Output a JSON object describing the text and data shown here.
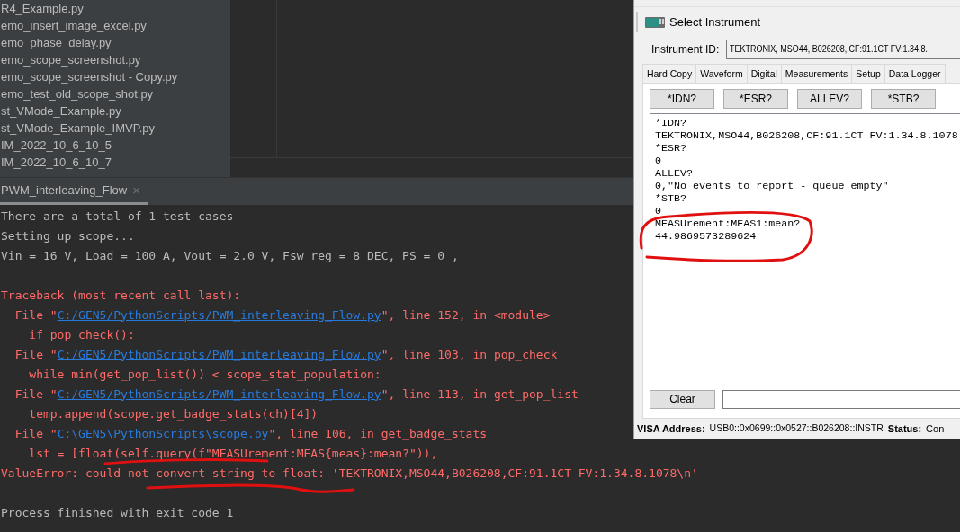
{
  "project_tree": {
    "files": [
      "R4_Example.py",
      "emo_insert_image_excel.py",
      "emo_phase_delay.py",
      "emo_scope_screenshot.py",
      "emo_scope_screenshot - Copy.py",
      "emo_test_old_scope_shot.py",
      "st_VMode_Example.py",
      "st_VMode_Example_IMVP.py",
      "IM_2022_10_6_10_5",
      "IM_2022_10_6_10_7"
    ]
  },
  "run_tab": {
    "label": "PWM_interleaving_Flow",
    "close": "×"
  },
  "console": {
    "blocks": [
      {
        "lines": [
          {
            "segments": [
              {
                "kind": "out",
                "text": "There are a total of 1 test cases"
              }
            ]
          },
          {
            "segments": [
              {
                "kind": "out",
                "text": "Setting up scope..."
              }
            ]
          },
          {
            "segments": [
              {
                "kind": "out",
                "text": "Vin = 16 V, Load = 100 A, Vout = 2.0 V, Fsw reg = 8 DEC, PS = 0 ,"
              }
            ]
          }
        ]
      },
      {
        "lines": [
          {
            "segments": [
              {
                "kind": "err",
                "text": "Traceback (most recent call last):"
              }
            ]
          },
          {
            "segments": [
              {
                "kind": "err",
                "text": "  File \""
              },
              {
                "kind": "link",
                "text": "C:/GEN5/PythonScripts/PWM_interleaving_Flow.py"
              },
              {
                "kind": "err",
                "text": "\", line 152, in <module>"
              }
            ]
          },
          {
            "segments": [
              {
                "kind": "err",
                "text": "    if pop_check():"
              }
            ]
          },
          {
            "segments": [
              {
                "kind": "err",
                "text": "  File \""
              },
              {
                "kind": "link",
                "text": "C:/GEN5/PythonScripts/PWM_interleaving_Flow.py"
              },
              {
                "kind": "err",
                "text": "\", line 103, in pop_check"
              }
            ]
          },
          {
            "segments": [
              {
                "kind": "err",
                "text": "    while min(get_pop_list()) < scope_stat_population:"
              }
            ]
          },
          {
            "segments": [
              {
                "kind": "err",
                "text": "  File \""
              },
              {
                "kind": "link",
                "text": "C:/GEN5/PythonScripts/PWM_interleaving_Flow.py"
              },
              {
                "kind": "err",
                "text": "\", line 113, in get_pop_list"
              }
            ]
          },
          {
            "segments": [
              {
                "kind": "err",
                "text": "    temp.append(scope.get_badge_stats(ch)[4])"
              }
            ]
          },
          {
            "segments": [
              {
                "kind": "err",
                "text": "  File \""
              },
              {
                "kind": "link",
                "text": "C:\\GEN5\\PythonScripts\\scope.py"
              },
              {
                "kind": "err",
                "text": "\", line 106, in get_badge_stats"
              }
            ]
          },
          {
            "segments": [
              {
                "kind": "err",
                "text": "    lst = [float(self.query(f\"MEASUrement:MEAS{meas}:mean?\")),"
              }
            ]
          },
          {
            "segments": [
              {
                "kind": "err",
                "text": "ValueError: could not convert string to float: 'TEKTRONIX,MSO44,B026208,CF:91.1CT FV:1.34.8.1078\\n'"
              }
            ]
          }
        ]
      },
      {
        "lines": [
          {
            "segments": [
              {
                "kind": "out",
                "text": "Process finished with exit code 1"
              }
            ]
          }
        ]
      }
    ]
  },
  "dialog": {
    "title": "Select Instrument",
    "instrument_id_label": "Instrument ID:",
    "instrument_id_value": "TEKTRONIX, MSO44, B026208, CF:91.1CT FV:1.34.8.",
    "tabs": [
      "Hard Copy",
      "Waveform",
      "Digital",
      "Measurements",
      "Setup",
      "Data Logger"
    ],
    "query_buttons": [
      "*IDN?",
      "*ESR?",
      "ALLEV?",
      "*STB?"
    ],
    "output": [
      "*IDN?",
      "TEKTRONIX,MSO44,B026208,CF:91.1CT FV:1.34.8.1078",
      "*ESR?",
      "0",
      "ALLEV?",
      "0,\"No events to report - queue empty\"",
      "*STB?",
      "0",
      "MEASUrement:MEAS1:mean?",
      "44.9869573289624"
    ],
    "clear_button": "Clear",
    "status_bar": {
      "visa_label": "VISA Address:",
      "visa_value": "USB0::0x0699::0x0527::B026208::INSTR",
      "status_label": "Status:",
      "status_value": "Con"
    }
  }
}
